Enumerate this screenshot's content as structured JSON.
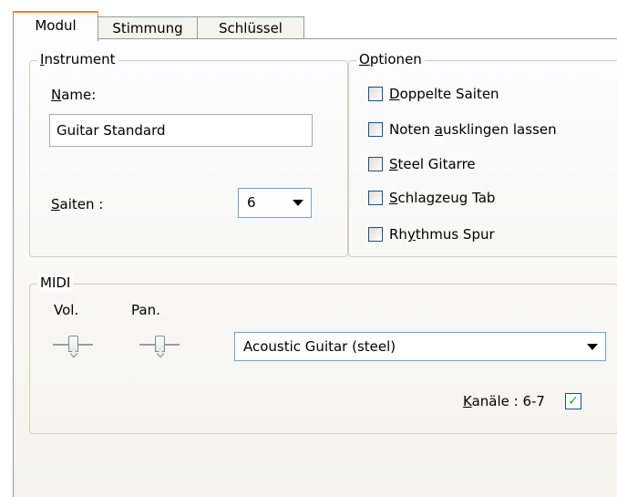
{
  "tabs": [
    {
      "label": "Modul",
      "active": true
    },
    {
      "label": "Stimmung",
      "active": false
    },
    {
      "label": "Schlüssel",
      "active": false
    }
  ],
  "instrument": {
    "title_hotkey": "I",
    "title_rest": "nstrument",
    "name_label_hotkey": "N",
    "name_label_rest": "ame:",
    "name_value": "Guitar Standard",
    "strings_label_hotkey": "S",
    "strings_label_rest": "aiten :",
    "strings_value": "6"
  },
  "options": {
    "title_hotkey": "O",
    "title_rest": "ptionen",
    "items": [
      {
        "pre": "",
        "hotkey": "D",
        "post": "oppelte Saiten",
        "checked": false
      },
      {
        "pre": "Noten ",
        "hotkey": "a",
        "post": "usklingen lassen",
        "checked": false
      },
      {
        "pre": "",
        "hotkey": "S",
        "post": "teel Gitarre",
        "checked": false
      },
      {
        "pre": "",
        "hotkey": "S",
        "post": "chlagzeug Tab",
        "checked": false
      },
      {
        "pre": "Rh",
        "hotkey": "y",
        "post": "thmus Spur",
        "checked": false
      }
    ]
  },
  "midi": {
    "title": "MIDI",
    "vol_label": "Vol.",
    "pan_label": "Pan.",
    "vol_level": 0.5,
    "pan_level": 0.5,
    "instrument_value": "Acoustic Guitar (steel)",
    "channels_hotkey": "K",
    "channels_rest": "anäle : 6-7",
    "channels_checked": true,
    "check_glyph": "✓"
  },
  "colors": {
    "active_tab_accent": "#e68b2c",
    "group_border": "#d0d0bf",
    "checkmark": "#21a121"
  }
}
